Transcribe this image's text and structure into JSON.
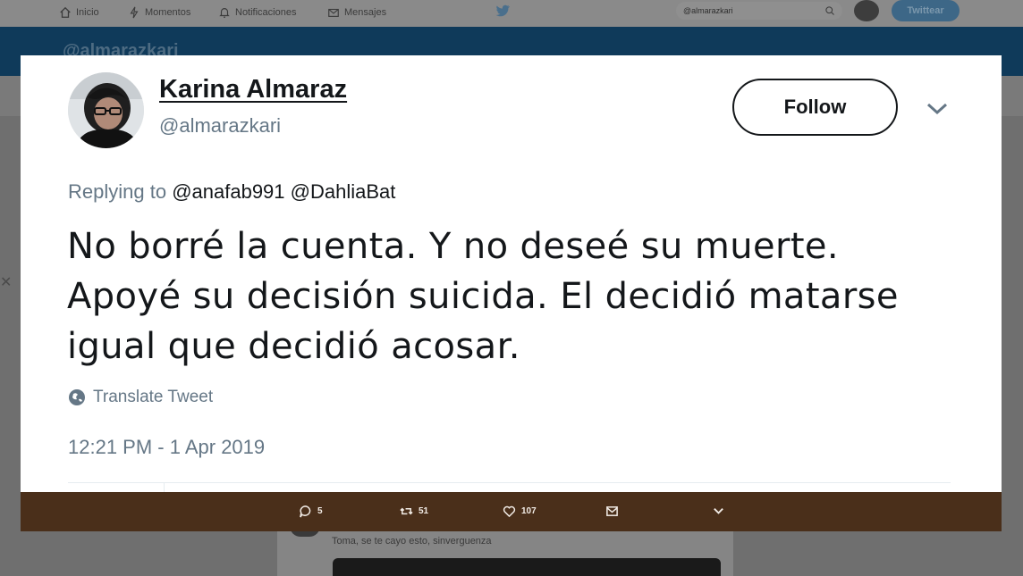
{
  "nav": {
    "items": [
      {
        "label": "Inicio",
        "icon": "home-icon"
      },
      {
        "label": "Momentos",
        "icon": "lightning-icon"
      },
      {
        "label": "Notificaciones",
        "icon": "bell-icon"
      },
      {
        "label": "Mensajes",
        "icon": "mail-icon"
      }
    ],
    "search_value": "@almarazkari",
    "tweet_button": "Twittear"
  },
  "profile_banner": {
    "handle": "@almarazkari"
  },
  "tweet": {
    "display_name": "Karina Almaraz",
    "handle": "@almarazkari",
    "follow_label": "Follow",
    "replying_prefix": "Replying to",
    "replying_mentions": "@anafab991 @DahliaBat",
    "text": "No borré la cuenta. Y no deseé su muerte. Apoyé su decisión suicida. El decidió matarse igual que decidió acosar.",
    "translate_label": "Translate Tweet",
    "timestamp": "12:21 PM - 1 Apr 2019"
  },
  "actions": {
    "replies": "5",
    "retweets": "51",
    "likes": "107"
  },
  "reply_preview": {
    "text": "Toma, se te cayo esto, sinverguenza"
  },
  "colors": {
    "brand": "#1da1f2",
    "action_bar": "#4a2f1a",
    "secondary_text": "#657786"
  }
}
